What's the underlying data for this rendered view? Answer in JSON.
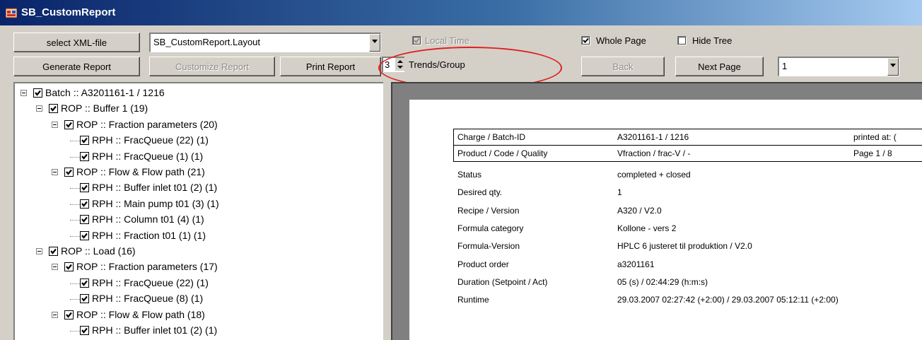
{
  "window": {
    "title": "SB_CustomReport"
  },
  "toolbar": {
    "select_xml_label": "select XML-file",
    "layout_combo_value": "SB_CustomReport.Layout",
    "generate_label": "Generate Report",
    "customize_label": "Customize Report",
    "print_label": "Print Report",
    "local_time_label": "Local Time",
    "whole_page_label": "Whole Page",
    "hide_tree_label": "Hide Tree",
    "trends_value": "3",
    "trends_label": "Trends/Group",
    "back_label": "Back",
    "next_label": "Next Page",
    "page_combo_value": "1"
  },
  "tree": [
    {
      "label": "Batch :: A3201161-1 / 1216",
      "expander": true
    },
    {
      "label": "ROP :: Buffer 1 (19)",
      "expander": true
    },
    {
      "label": "ROP :: Fraction parameters (20)",
      "expander": true
    },
    {
      "label": "RPH :: FracQueue (22) (1)",
      "expander": false
    },
    {
      "label": "RPH :: FracQueue (1) (1)",
      "expander": false
    },
    {
      "label": "ROP :: Flow & Flow path (21)",
      "expander": true
    },
    {
      "label": "RPH :: Buffer inlet t01 (2) (1)",
      "expander": false
    },
    {
      "label": "RPH :: Main pump t01 (3) (1)",
      "expander": false
    },
    {
      "label": "RPH :: Column t01 (4) (1)",
      "expander": false
    },
    {
      "label": "RPH :: Fraction t01 (1) (1)",
      "expander": false
    },
    {
      "label": "ROP :: Load (16)",
      "expander": true
    },
    {
      "label": "ROP :: Fraction parameters (17)",
      "expander": true
    },
    {
      "label": "RPH :: FracQueue (22) (1)",
      "expander": false
    },
    {
      "label": "RPH :: FracQueue (8) (1)",
      "expander": false
    },
    {
      "label": "ROP :: Flow & Flow path (18)",
      "expander": true
    },
    {
      "label": "RPH :: Buffer inlet t01 (2) (1)",
      "expander": false
    }
  ],
  "report": {
    "header": [
      {
        "label": "Charge / Batch-ID",
        "value": "A3201161-1 / 1216",
        "right": "printed at: ("
      },
      {
        "label": "Product / Code / Quality",
        "value": "Vfraction / frac-V / -",
        "right": "Page 1 / 8"
      }
    ],
    "rows": [
      {
        "label": "Status",
        "value": "completed + closed"
      },
      {
        "label": "Desired qty.",
        "value": "1"
      },
      {
        "label": "Recipe / Version",
        "value": "A320 / V2.0"
      },
      {
        "label": "Formula category",
        "value": "Kollone - vers 2"
      },
      {
        "label": "Formula-Version",
        "value": "HPLC 6 justeret til produktion / V2.0"
      },
      {
        "label": "Product order",
        "value": "a3201161"
      },
      {
        "label": "Duration (Setpoint / Act)",
        "value": "05 (s) / 02:44:29 (h:m:s)"
      },
      {
        "label": "Runtime",
        "value": "29.03.2007 02:27:42 (+2:00) / 29.03.2007 05:12:11 (+2:00)"
      }
    ]
  },
  "colors": {
    "titlebar_start": "#0a246a",
    "callout": "#e02020",
    "face": "#d4d0c8"
  }
}
